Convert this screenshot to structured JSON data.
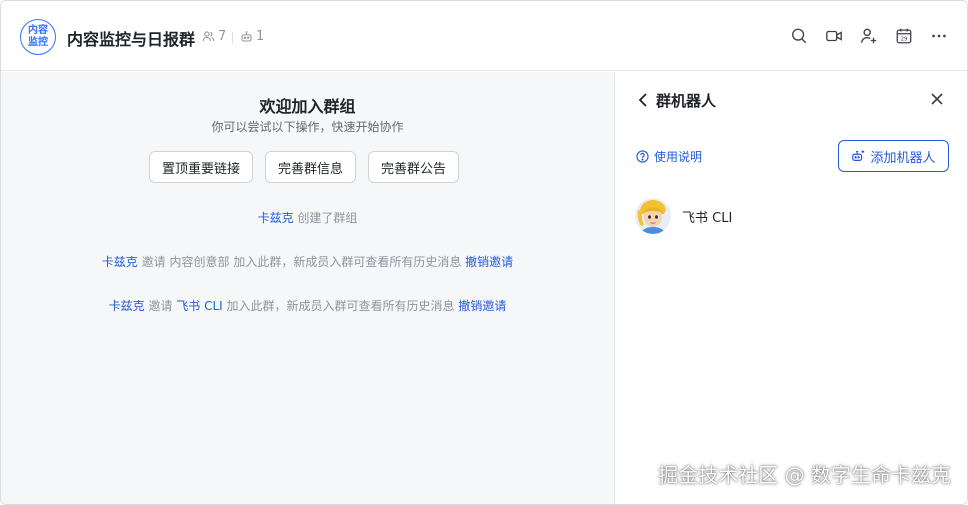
{
  "header": {
    "avatar_text": "内容监控",
    "title": "内容监控与日报群",
    "member_count": "7",
    "bot_count": "1",
    "icons": [
      "search-icon",
      "video-icon",
      "add-member-icon",
      "calendar-icon",
      "more-icon"
    ]
  },
  "chat": {
    "welcome_title": "欢迎加入群组",
    "welcome_subtitle": "你可以尝试以下操作，快速开始协作",
    "actions": [
      "置顶重要链接",
      "完善群信息",
      "完善群公告"
    ],
    "messages": [
      {
        "actor": "卡兹克",
        "text": "创建了群组"
      },
      {
        "actor": "卡兹克",
        "verb": "邀请",
        "target": "内容创意部",
        "text": "加入此群，新成员入群可查看所有历史消息",
        "action": "撤销邀请"
      },
      {
        "actor": "卡兹克",
        "verb": "邀请",
        "target": "飞书 CLI",
        "text": "加入此群，新成员入群可查看所有历史消息",
        "action": "撤销邀请"
      }
    ]
  },
  "panel": {
    "title": "群机器人",
    "help_label": "使用说明",
    "add_label": "添加机器人",
    "bots": [
      {
        "name": "飞书 CLI"
      }
    ]
  },
  "watermark": "掘金技术社区 @ 数字生命卡兹克",
  "colors": {
    "accent": "#245bdb",
    "avatar_border": "#3370ff",
    "chat_bg": "#f6f7f8"
  }
}
